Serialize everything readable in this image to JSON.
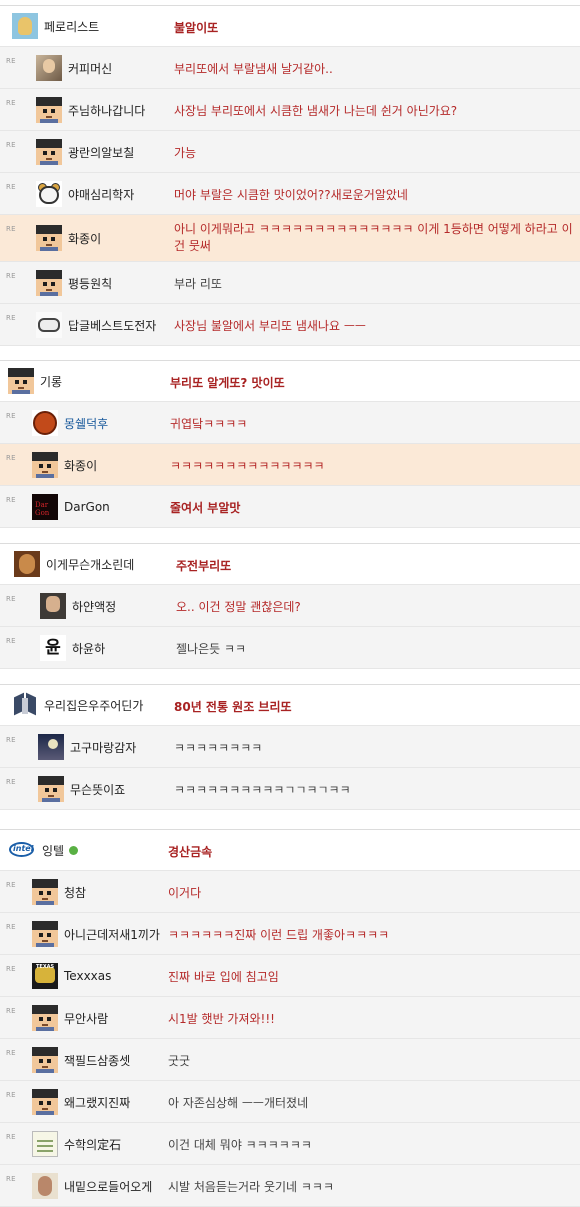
{
  "threads": [
    {
      "main": {
        "name": "페로리스트",
        "avatar": "duck-avatar",
        "text": "불알이또",
        "style": "bold"
      },
      "replies": [
        {
          "name": "커피머신",
          "avatar": "photo-avatar",
          "text": "부리또에서 부랄냄새 날거같아..",
          "style": "red"
        },
        {
          "name": "주님하나갑니다",
          "avatar": "pixel-face-avatar",
          "text": "사장님 부리또에서 시큼한 냄새가 나는데 쉰거 아닌가요?",
          "style": "red"
        },
        {
          "name": "광란의알보칠",
          "avatar": "pixel-face-avatar",
          "text": "가능",
          "style": "red"
        },
        {
          "name": "야매심리학자",
          "avatar": "bear-avatar",
          "text": "머야 부랄은 시큼한 맛이었어??새로운거알았네",
          "style": "red"
        },
        {
          "name": "화종이",
          "avatar": "pixel-face-avatar",
          "text": "아니 이게뭐라고 ㅋㅋㅋㅋㅋㅋㅋㅋㅋㅋㅋㅋㅋㅋ 이게 1등하면 어떻게 하라고 이건 뭇써",
          "style": "red",
          "highlight": true
        },
        {
          "name": "평등원칙",
          "avatar": "pixel-face-avatar",
          "text": "부라 리또",
          "style": "plain"
        },
        {
          "name": "답글베스트도전자",
          "avatar": "gamepad-avatar",
          "text": "사장님 불알에서 부리또 냄새나요 ㅡㅡ",
          "style": "red"
        }
      ]
    },
    {
      "main": {
        "name": "기롱",
        "avatar": "pixel-face-avatar",
        "text": "부리또 알게또? 맛이또",
        "style": "bold"
      },
      "replies": [
        {
          "name": "몽쉘덕후",
          "avatar": "shell-avatar",
          "text": "귀엽닼ㅋㅋㅋㅋ",
          "style": "red",
          "blue": true
        },
        {
          "name": "화종이",
          "avatar": "pixel-face-avatar",
          "text": "ㅋㅋㅋㅋㅋㅋㅋㅋㅋㅋㅋㅋㅋㅋ",
          "style": "red",
          "highlight": true
        },
        {
          "name": "DarGon",
          "avatar": "dark-avatar",
          "avatar_text": "Dar Gon",
          "text": "줄여서 부알맛",
          "style": "bold"
        }
      ]
    },
    {
      "main": {
        "name": "이게무슨개소린데",
        "avatar": "dog-avatar",
        "text": "주전부리또",
        "style": "bold"
      },
      "replies": [
        {
          "name": "하얀액정",
          "avatar": "anime-avatar",
          "text": "오.. 이건 정말 괜찮은데?",
          "style": "red"
        },
        {
          "name": "하윤하",
          "avatar": "yun-avatar",
          "avatar_text": "윤",
          "text": "젤나은듯 ㅋㅋ",
          "style": "plain"
        }
      ]
    },
    {
      "main": {
        "name": "우리집은우주어딘가",
        "avatar": "dragon-avatar",
        "text": "80년 전통 원조 브리또",
        "style": "bold"
      },
      "replies": [
        {
          "name": "고구마랑감자",
          "avatar": "night-avatar",
          "text": "ㅋㅋㅋㅋㅋㅋㅋㅋ",
          "style": "plain"
        },
        {
          "name": "무슨뜻이죠",
          "avatar": "pixel-face-avatar",
          "text": "ㅋㅋㅋㅋㅋㅋㅋㅋㅋㅋㄱㄱㅋㄱㅋㅋ",
          "style": "plain"
        }
      ]
    },
    {
      "main": {
        "name": "잉텔",
        "avatar": "intel-avatar",
        "avatar_text": "intel",
        "text": "경산금속",
        "style": "bold",
        "bubble": true
      },
      "replies": [
        {
          "name": "청참",
          "avatar": "pixel-face-avatar",
          "text": "이거다",
          "style": "red"
        },
        {
          "name": "아니근데저새1끼가",
          "avatar": "pixel-face-avatar",
          "text": "ㅋㅋㅋㅋㅋㅋ진짜 이런 드립 개좋아ㅋㅋㅋㅋ",
          "style": "red"
        },
        {
          "name": "Texxxas",
          "avatar": "texas-avatar",
          "avatar_text": "TEXAS",
          "text": "진짜 바로 입에 침고임",
          "style": "red"
        },
        {
          "name": "무안사람",
          "avatar": "pixel-face-avatar",
          "text": "시1발 햇반 가져와!!!",
          "style": "red"
        },
        {
          "name": "잭필드삼종셋",
          "avatar": "pixel-face-avatar",
          "text": "굿굿",
          "style": "plain"
        },
        {
          "name": "왜그랬지진짜",
          "avatar": "pixel-face-avatar",
          "text": "아 자존심상해 ㅡㅡ개터졌네",
          "style": "plain"
        },
        {
          "name": "수학의定石",
          "avatar": "book-avatar",
          "text": "이건 대체 뭐야 ㅋㅋㅋㅋㅋㅋ",
          "style": "plain"
        },
        {
          "name": "내밑으로들어오게",
          "avatar": "sock-avatar",
          "text": "시발 처음듣는거라 웃기네 ㅋㅋㅋ",
          "style": "plain"
        }
      ]
    }
  ],
  "re_label": "RE"
}
